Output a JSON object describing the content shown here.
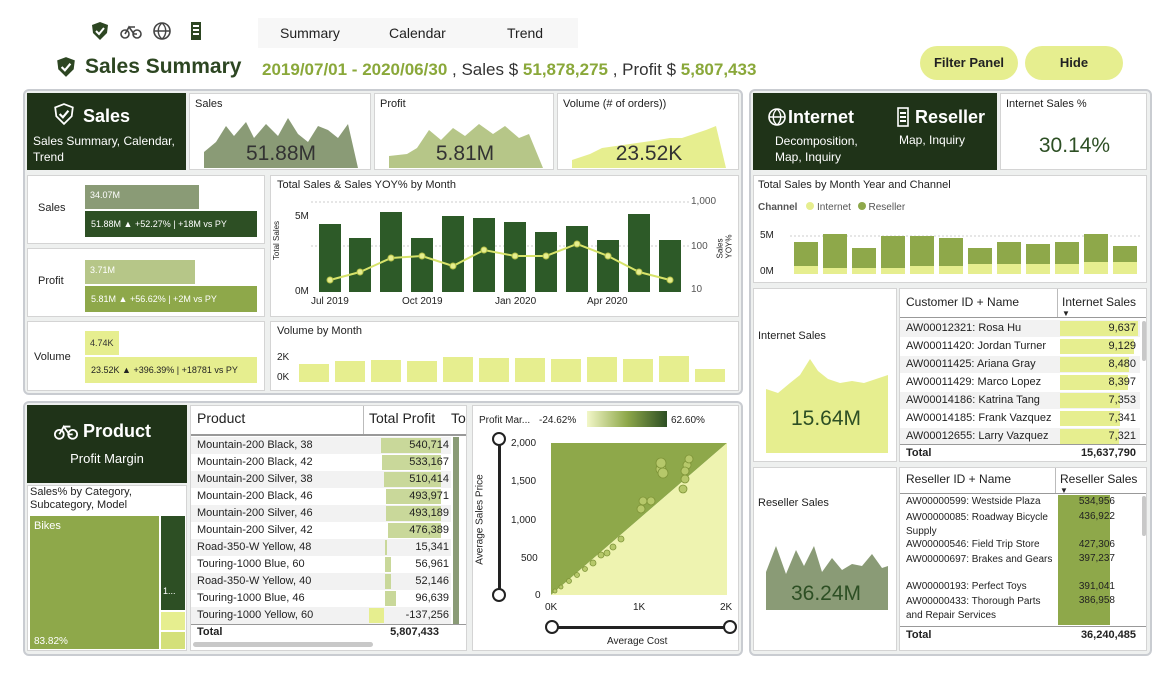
{
  "nav": {
    "tab_summary": "Summary",
    "tab_calendar": "Calendar",
    "tab_trend": "Trend"
  },
  "header": {
    "title": "Sales Summary",
    "date_range": "2019/07/01 - 2020/06/30",
    "sales_prefix": ", Sales $",
    "sales_value": "51,878,275",
    "profit_prefix": ", Profit $",
    "profit_value": "5,807,433",
    "filter_button": "Filter Panel",
    "hide_button": "Hide"
  },
  "sales_nav": {
    "title": "Sales",
    "subtitle": "Sales Summary, Calendar, Trend"
  },
  "kpis": {
    "sales": {
      "label": "Sales",
      "value": "51.88M"
    },
    "profit": {
      "label": "Profit",
      "value": "5.81M"
    },
    "volume": {
      "label": "Volume (# of orders))",
      "value": "23.52K"
    }
  },
  "kpi_bars": [
    {
      "label": "Sales",
      "py": "34.07M",
      "cy": "51.88M",
      "delta": "▲ +52.27% | +18M vs PY",
      "py_frac": 0.67,
      "cy_frac": 1.0
    },
    {
      "label": "Profit",
      "py": "3.71M",
      "cy": "5.81M",
      "delta": "▲ +56.62% | +2M vs PY",
      "py_frac": 0.64,
      "cy_frac": 1.0
    },
    {
      "label": "Volume",
      "py": "4.74K",
      "cy": "23.52K",
      "delta": "▲ +396.39% | +18781 vs PY",
      "py_frac": 0.2,
      "cy_frac": 1.0
    }
  ],
  "combo_chart": {
    "title": "Total Sales & Sales YOY% by Month",
    "ylabel": "Total Sales",
    "y2label": "Sales YOY%",
    "yticks": [
      "5M",
      "0M"
    ],
    "y2ticks": [
      "1,000",
      "100",
      "10"
    ],
    "xticks": [
      "Jul 2019",
      "Oct 2019",
      "Jan 2020",
      "Apr 2020"
    ]
  },
  "volume_chart": {
    "title": "Volume by Month",
    "yticks": [
      "2K",
      "0K"
    ]
  },
  "channel_nav": {
    "internet_title": "Internet",
    "internet_sub": "Decomposition, Map, Inquiry",
    "reseller_title": "Reseller",
    "reseller_sub": "Map, Inquiry"
  },
  "internet_pct": {
    "label": "Internet Sales %",
    "value": "30.14%"
  },
  "channel_chart": {
    "title": "Total Sales by Month Year and Channel",
    "legend_title": "Channel",
    "legend": [
      "Internet",
      "Reseller"
    ],
    "yticks": [
      "5M",
      "0M"
    ]
  },
  "internet_card": {
    "label": "Internet Sales",
    "value": "15.64M"
  },
  "reseller_card": {
    "label": "Reseller Sales",
    "value": "36.24M"
  },
  "customer_table": {
    "col1": "Customer ID + Name",
    "col2": "Internet Sales",
    "rows": [
      {
        "name": "AW00012321: Rosa Hu",
        "value": "9,637"
      },
      {
        "name": "AW00011420: Jordan Turner",
        "value": "9,129"
      },
      {
        "name": "AW00011425: Ariana Gray",
        "value": "8,480"
      },
      {
        "name": "AW00011429: Marco Lopez",
        "value": "8,397"
      },
      {
        "name": "AW00014186: Katrina Tang",
        "value": "7,353"
      },
      {
        "name": "AW00014185: Frank Vazquez",
        "value": "7,341"
      },
      {
        "name": "AW00012655: Larry Vazquez",
        "value": "7,321"
      }
    ],
    "total_label": "Total",
    "total": "15,637,790"
  },
  "reseller_table": {
    "col1": "Reseller ID + Name",
    "col2": "Reseller Sales",
    "rows": [
      {
        "name": "AW00000599: Westside Plaza",
        "value": "534,956"
      },
      {
        "name": "AW00000085: Roadway Bicycle Supply",
        "value": "436,922"
      },
      {
        "name": "AW00000546: Field Trip Store",
        "value": "427,306"
      },
      {
        "name": "AW00000697: Brakes and Gears",
        "value": "397,237"
      },
      {
        "name": "AW00000193: Perfect Toys",
        "value": "391,041"
      },
      {
        "name": "AW00000433: Thorough Parts and Repair Services",
        "value": "386,958"
      }
    ],
    "total_label": "Total",
    "total": "36,240,485"
  },
  "product_nav": {
    "title": "Product",
    "subtitle": "Profit Margin"
  },
  "treemap": {
    "title": "Sales% by Category, Subcategory, Model",
    "main": "Bikes",
    "pct": "83.82%",
    "small": "1..."
  },
  "product_table": {
    "col1": "Product",
    "col2": "Total Profit",
    "col3": "To",
    "rows": [
      {
        "name": "Mountain-200 Black, 38",
        "value": "540,714"
      },
      {
        "name": "Mountain-200 Black, 42",
        "value": "533,167"
      },
      {
        "name": "Mountain-200 Silver, 38",
        "value": "510,414"
      },
      {
        "name": "Mountain-200 Black, 46",
        "value": "493,971"
      },
      {
        "name": "Mountain-200 Silver, 46",
        "value": "493,189"
      },
      {
        "name": "Mountain-200 Silver, 42",
        "value": "476,389"
      },
      {
        "name": "Road-350-W Yellow, 48",
        "value": "15,341"
      },
      {
        "name": "Touring-1000 Blue, 60",
        "value": "56,961"
      },
      {
        "name": "Road-350-W Yellow, 40",
        "value": "52,146"
      },
      {
        "name": "Touring-1000 Blue, 46",
        "value": "96,639"
      },
      {
        "name": "Touring-1000 Yellow, 60",
        "value": "-137,256"
      }
    ],
    "total_label": "Total",
    "total": "5,807,433"
  },
  "scatter": {
    "legend_title": "Profit Mar...",
    "legend_min": "-24.62%",
    "legend_max": "62.60%",
    "ylabel": "Average Sales Price",
    "xlabel": "Average Cost",
    "yticks": [
      "2,000",
      "1,500",
      "1,000",
      "500",
      "0"
    ],
    "xticks": [
      "0K",
      "1K",
      "2K"
    ]
  },
  "colors": {
    "dark": "#1f3318",
    "accent": "#8ea84a",
    "light": "#e6ee8f",
    "title_green": "#8aa83a"
  }
}
